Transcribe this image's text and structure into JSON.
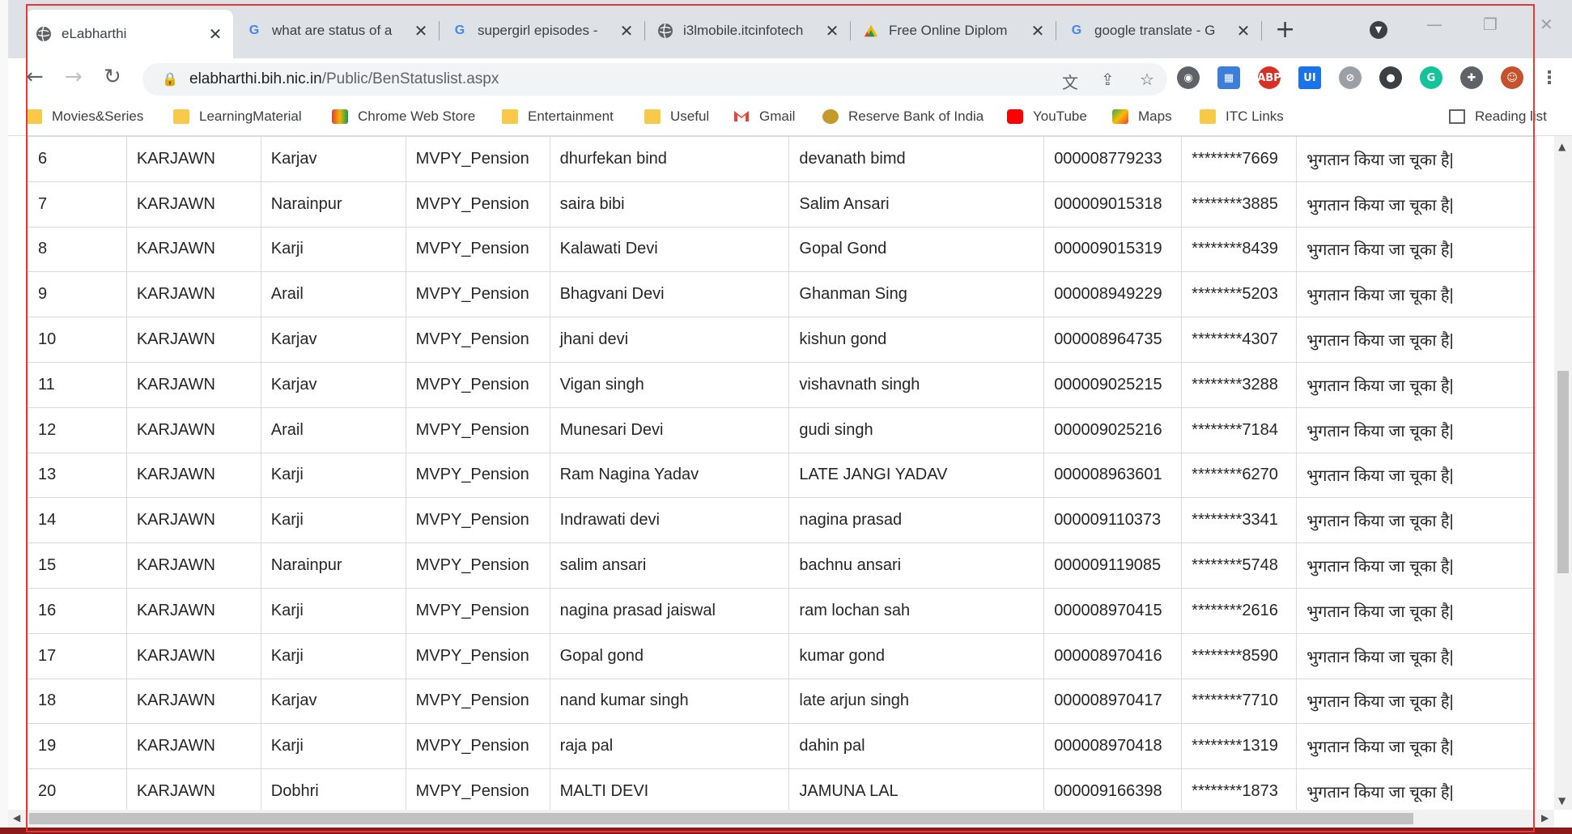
{
  "tabs": [
    {
      "title": "eLabharthi",
      "icon": "globe-icon",
      "active": true
    },
    {
      "title": "what are status of a",
      "icon": "google-icon"
    },
    {
      "title": "supergirl episodes -",
      "icon": "google-icon"
    },
    {
      "title": "i3lmobile.itcinfotech",
      "icon": "globe-icon"
    },
    {
      "title": "Free Online Diplom",
      "icon": "alison-icon"
    },
    {
      "title": "google translate - G",
      "icon": "google-icon"
    }
  ],
  "toolbar": {
    "url_host": "elabharthi.bih.nic.in",
    "url_path": "/Public/BenStatuslist.aspx"
  },
  "bookmarks": [
    {
      "label": "Movies&Series",
      "icon": "folder-icon"
    },
    {
      "label": "LearningMaterial",
      "icon": "folder-icon"
    },
    {
      "label": "Chrome Web Store",
      "icon": "chrome-web-store-icon"
    },
    {
      "label": "Entertainment",
      "icon": "folder-icon"
    },
    {
      "label": "Useful",
      "icon": "folder-icon"
    },
    {
      "label": "Gmail",
      "icon": "gmail-icon"
    },
    {
      "label": "Reserve Bank of India",
      "icon": "rbi-icon"
    },
    {
      "label": "YouTube",
      "icon": "youtube-icon"
    },
    {
      "label": "Maps",
      "icon": "maps-icon"
    },
    {
      "label": "ITC Links",
      "icon": "folder-icon"
    }
  ],
  "reading_list": "Reading list",
  "rows": [
    [
      "6",
      "KARJAWN",
      "Karjav",
      "MVPY_Pension",
      "dhurfekan bind",
      "devanath bimd",
      "000008779233",
      "********7669",
      "भुगतान किया जा चूका है|"
    ],
    [
      "7",
      "KARJAWN",
      "Narainpur",
      "MVPY_Pension",
      "saira bibi",
      "Salim Ansari",
      "000009015318",
      "********3885",
      "भुगतान किया जा चूका है|"
    ],
    [
      "8",
      "KARJAWN",
      "Karji",
      "MVPY_Pension",
      "Kalawati Devi",
      "Gopal Gond",
      "000009015319",
      "********8439",
      "भुगतान किया जा चूका है|"
    ],
    [
      "9",
      "KARJAWN",
      "Arail",
      "MVPY_Pension",
      "Bhagvani Devi",
      "Ghanman Sing",
      "000008949229",
      "********5203",
      "भुगतान किया जा चूका है|"
    ],
    [
      "10",
      "KARJAWN",
      "Karjav",
      "MVPY_Pension",
      "jhani devi",
      "kishun gond",
      "000008964735",
      "********4307",
      "भुगतान किया जा चूका है|"
    ],
    [
      "11",
      "KARJAWN",
      "Karjav",
      "MVPY_Pension",
      "Vigan singh",
      "vishavnath singh",
      "000009025215",
      "********3288",
      "भुगतान किया जा चूका है|"
    ],
    [
      "12",
      "KARJAWN",
      "Arail",
      "MVPY_Pension",
      "Munesari Devi",
      "gudi singh",
      "000009025216",
      "********7184",
      "भुगतान किया जा चूका है|"
    ],
    [
      "13",
      "KARJAWN",
      "Karji",
      "MVPY_Pension",
      "Ram Nagina Yadav",
      "LATE JANGI YADAV",
      "000008963601",
      "********6270",
      "भुगतान किया जा चूका है|"
    ],
    [
      "14",
      "KARJAWN",
      "Karji",
      "MVPY_Pension",
      "Indrawati devi",
      "nagina prasad",
      "000009110373",
      "********3341",
      "भुगतान किया जा चूका है|"
    ],
    [
      "15",
      "KARJAWN",
      "Narainpur",
      "MVPY_Pension",
      "salim ansari",
      "bachnu ansari",
      "000009119085",
      "********5748",
      "भुगतान किया जा चूका है|"
    ],
    [
      "16",
      "KARJAWN",
      "Karji",
      "MVPY_Pension",
      "nagina prasad jaiswal",
      "ram lochan sah",
      "000008970415",
      "********2616",
      "भुगतान किया जा चूका है|"
    ],
    [
      "17",
      "KARJAWN",
      "Karji",
      "MVPY_Pension",
      "Gopal gond",
      "kumar gond",
      "000008970416",
      "********8590",
      "भुगतान किया जा चूका है|"
    ],
    [
      "18",
      "KARJAWN",
      "Karjav",
      "MVPY_Pension",
      "nand kumar singh",
      "late arjun singh",
      "000008970417",
      "********7710",
      "भुगतान किया जा चूका है|"
    ],
    [
      "19",
      "KARJAWN",
      "Karji",
      "MVPY_Pension",
      "raja pal",
      "dahin pal",
      "000008970418",
      "********1319",
      "भुगतान किया जा चूका है|"
    ],
    [
      "20",
      "KARJAWN",
      "Dobhri",
      "MVPY_Pension",
      "MALTI DEVI",
      "JAMUNA LAL",
      "000009166398",
      "********1873",
      "भुगतान किया जा चूका है|"
    ]
  ],
  "colors": {
    "highlight": "#e53935",
    "tabstrip": "#dee1e6"
  }
}
